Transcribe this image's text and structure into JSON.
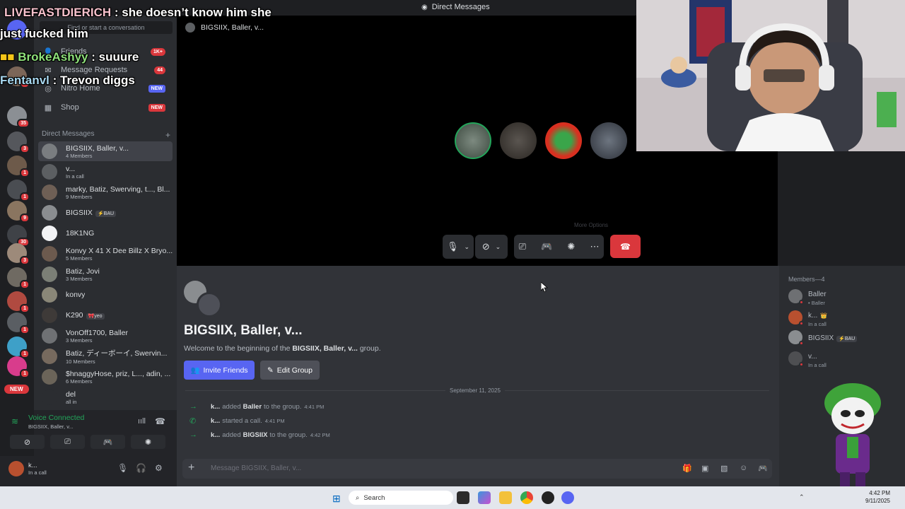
{
  "topbar": {
    "title": "Direct Messages"
  },
  "sidebar": {
    "search_placeholder": "Find or start a conversation",
    "nav": [
      {
        "label": "Friends",
        "badge": "1K+"
      },
      {
        "label": "Message Requests",
        "badge": "44"
      },
      {
        "label": "Nitro Home",
        "badge": "NEW"
      },
      {
        "label": "Shop",
        "badge": "NEW"
      }
    ],
    "dm_header": "Direct Messages",
    "dm_add": "+",
    "dms": [
      {
        "name": "BIGSIIX, Baller, v...",
        "sub": "4 Members",
        "color": "#7a7d80"
      },
      {
        "name": "v...",
        "sub": "In a call",
        "color": "#5c5f62"
      },
      {
        "name": "marky, Batiz, Swerving, t..., Bl...",
        "sub": "9 Members",
        "color": "#6e5f55"
      },
      {
        "name": "BIGSIIX",
        "sub": "",
        "tag": "⚡BAU",
        "color": "#8a8d90"
      },
      {
        "name": "18K1NG",
        "sub": "",
        "color": "#f2f3f5"
      },
      {
        "name": "Konvy X 41 X Dee Billz X Bryo...",
        "sub": "5 Members",
        "color": "#6c5a4e"
      },
      {
        "name": "Batiz, Jovi",
        "sub": "3 Members",
        "color": "#7b7f76"
      },
      {
        "name": "konvy",
        "sub": "",
        "color": "#8a8778"
      },
      {
        "name": "K290",
        "sub": "",
        "tag": "🎀yeo",
        "color": "#3e3a38"
      },
      {
        "name": "VonOff1700, Baller",
        "sub": "3 Members",
        "color": "#6f7174"
      },
      {
        "name": "Batiz, ディーボーイ, Swervin...",
        "sub": "10 Members",
        "color": "#776a5e"
      },
      {
        "name": "$hnaggyHose, priz, L..., adin, ...",
        "sub": "6 Members",
        "color": "#6b6459"
      },
      {
        "name": "del",
        "sub": "all in",
        "color": "#2b2d31"
      }
    ],
    "server_badges": [
      "1",
      "35",
      "3",
      "1",
      "1",
      "9",
      "30",
      "3",
      "1",
      "1",
      "1",
      "1",
      "1"
    ],
    "new_pill": "NEW"
  },
  "voice": {
    "title": "Voice Connected",
    "channel": "BIGSIIX, Baller, v..."
  },
  "user": {
    "name": "k...",
    "status": "In a call"
  },
  "call": {
    "title": "BIGSIIX, Baller, v...",
    "more_options": "More Options"
  },
  "chat": {
    "group_title": "BIGSIIX, Baller, v...",
    "welcome_prefix": "Welcome to the beginning of the",
    "welcome_name": "BIGSIIX, Baller, v...",
    "welcome_suffix": "group.",
    "invite_label": "Invite Friends",
    "edit_label": "Edit Group",
    "date": "September 11, 2025",
    "messages": [
      {
        "actor": "k...",
        "action": "added",
        "target": "Baller",
        "rest": "to the group.",
        "time": "4:41 PM"
      },
      {
        "actor": "k...",
        "action": "started a call.",
        "target": "",
        "rest": "",
        "time": "4:41 PM"
      },
      {
        "actor": "k...",
        "action": "added",
        "target": "BIGSIIX",
        "rest": "to the group.",
        "time": "4:42 PM"
      }
    ],
    "composer_placeholder": "Message BIGSIIX, Baller, v..."
  },
  "members": {
    "title": "Members—4",
    "list": [
      {
        "name": "Baller",
        "sub": "• Baller",
        "color": "#6e7073"
      },
      {
        "name": "k...",
        "sub": "In a call",
        "badge": "👑",
        "color": "#b8502f"
      },
      {
        "name": "BIGSIIX",
        "sub": "",
        "tag": "⚡BAU",
        "color": "#8a8d90"
      },
      {
        "name": "v...",
        "sub": "In a call",
        "color": "#4e4f52"
      }
    ]
  },
  "overlay_chat": [
    {
      "user": "LIVEFASTDIERICH",
      "text": "she doesn’t know him she"
    },
    {
      "user": "",
      "text": "just fucked him"
    },
    {
      "user": "BrokeAshyy",
      "text": "suuure"
    },
    {
      "user": "Fentanvl",
      "text": "Trevon diggs"
    }
  ],
  "taskbar": {
    "search": "Search",
    "time": "4:42 PM",
    "date": "9/11/2025"
  },
  "colors": {
    "accent": "#5865f2",
    "danger": "#da373c",
    "online": "#23a55a"
  }
}
